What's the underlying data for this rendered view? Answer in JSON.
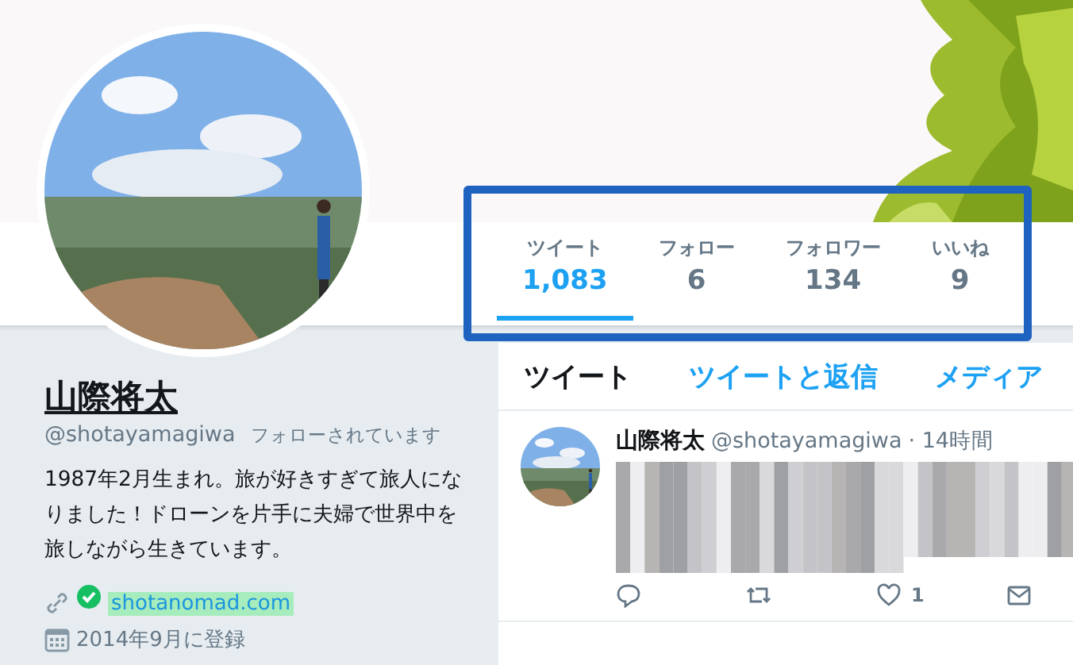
{
  "stats": [
    {
      "label": "ツイート",
      "value": "1,083",
      "selected": true
    },
    {
      "label": "フォロー",
      "value": "6",
      "selected": false
    },
    {
      "label": "フォロワー",
      "value": "134",
      "selected": false
    },
    {
      "label": "いいね",
      "value": "9",
      "selected": false
    }
  ],
  "profile": {
    "name": "山際将太",
    "handle": "@shotayamagiwa",
    "follows_you": "フォローされています",
    "bio": "1987年2月生まれ。旅が好きすぎて旅人になりました！ドローンを片手に夫婦で世界中を旅しながら生きています。",
    "website": "shotanomad.com",
    "website_verified": true,
    "website_highlighted": true,
    "joined": "2014年9月に登録"
  },
  "timeline_tabs": [
    {
      "label": "ツイート",
      "selected": true
    },
    {
      "label": "ツイートと返信",
      "selected": false
    },
    {
      "label": "メディア",
      "selected": false
    }
  ],
  "tweets": [
    {
      "name": "山際将太",
      "handle": "@shotayamagiwa",
      "time": "· 14時間",
      "text_blurred": true,
      "actions": [
        {
          "kind": "reply"
        },
        {
          "kind": "retweet"
        },
        {
          "kind": "like",
          "count": "1"
        },
        {
          "kind": "message"
        }
      ]
    }
  ],
  "annotation": {
    "kind": "frame",
    "color": "#1f63c0"
  }
}
